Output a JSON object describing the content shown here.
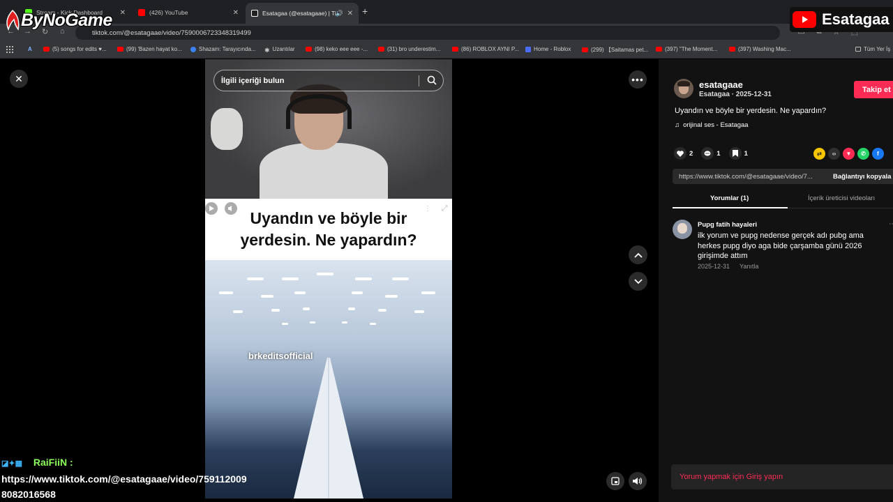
{
  "browser": {
    "tabs": [
      {
        "title": "Stream - Kick Dashboard",
        "favicon_color": "#53fc18"
      },
      {
        "title": "(426) YouTube",
        "favicon_color": "#ff0000"
      },
      {
        "title": "Esatagaa (@esatagaae) | Ti",
        "favicon_color": "#ffffff"
      }
    ],
    "url": "tiktok.com/@esatagaae/video/7590006723348319499",
    "bookmarks": [
      {
        "label": "(5) songs for edits ♥..."
      },
      {
        "label": "(99) 'Bazen hayat ko..."
      },
      {
        "label": "Shazam: Tarayıcında..."
      },
      {
        "label": "Uzantılar"
      },
      {
        "label": "(98) keko eee eee -..."
      },
      {
        "label": "(31) bro underestim..."
      },
      {
        "label": "(86) ROBLOX AYNI P..."
      },
      {
        "label": "Home - Roblox"
      },
      {
        "label": "(299) 【Saitamas pet..."
      },
      {
        "label": "(397) \"The Moment..."
      },
      {
        "label": "(397) Washing Mac..."
      },
      {
        "label": "Tüm Yer İş"
      }
    ]
  },
  "overlay": {
    "streamer_logo": "ByNoGame",
    "channel_name": "Esatagaa"
  },
  "video": {
    "search_placeholder": "İlgili içeriği bulun",
    "caption_line1": "Uyandın ve böyle bir",
    "caption_line2": "yerdesin. Ne yapardın?",
    "watermark": "brkeditsofficial"
  },
  "chat": {
    "username": "RaiFiiN :",
    "line1": "https://www.tiktok.com/@esatagaae/video/759112009",
    "line2": "8082016568"
  },
  "panel": {
    "username": "esatagaae",
    "subline": "Esatagaa · 2025-12-31",
    "follow_label": "Takip et",
    "description": "Uyandın ve böyle bir yerdesin. Ne yapardın?",
    "sound": "orijinal ses - Esatagaa",
    "likes": "2",
    "comments": "1",
    "saves": "1",
    "link": "https://www.tiktok.com/@esatagaae/video/7...",
    "copy_label": "Bağlantıyı kopyala",
    "tab_comments": "Yorumlar (1)",
    "tab_creator_videos": "İçerik üreticisi videoları",
    "comment": {
      "author": "Pupg fatih hayaleri",
      "text": "ilk yorum ve pupg nedense gerçek adı pubg ama herkes pupg diyo aga bide çarşamba günü 2026 girişimde attım",
      "date": "2025-12-31",
      "reply_label": "Yanıtla"
    },
    "login_prompt": "Yorum yapmak için Giriş yapın"
  },
  "colors": {
    "accent": "#fe2c55",
    "panel_bg": "#121212"
  }
}
